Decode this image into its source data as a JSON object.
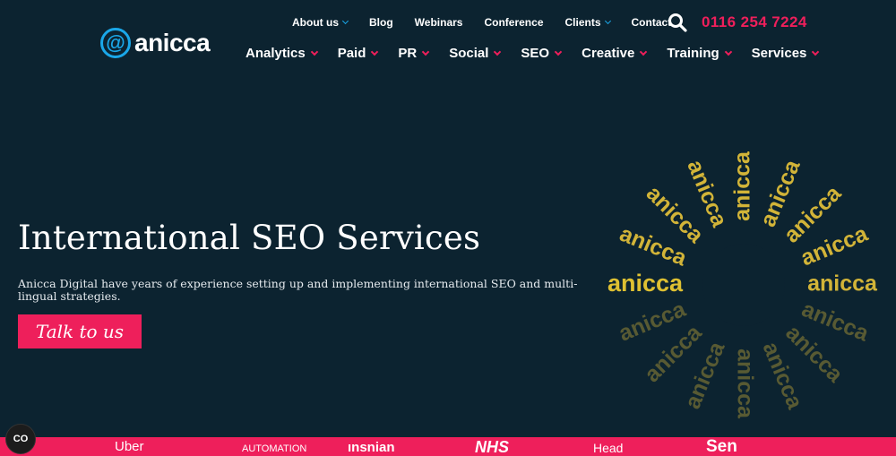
{
  "brand": {
    "name": "anicca",
    "at_symbol": "@"
  },
  "top_nav": [
    {
      "label": "About us",
      "dropdown": true
    },
    {
      "label": "Blog",
      "dropdown": false
    },
    {
      "label": "Webinars",
      "dropdown": false
    },
    {
      "label": "Conference",
      "dropdown": false
    },
    {
      "label": "Clients",
      "dropdown": true
    },
    {
      "label": "Contact",
      "dropdown": false
    }
  ],
  "phone": "0116 254 7224",
  "main_nav": [
    {
      "label": "Analytics"
    },
    {
      "label": "Paid"
    },
    {
      "label": "PR"
    },
    {
      "label": "Social"
    },
    {
      "label": "SEO"
    },
    {
      "label": "Creative"
    },
    {
      "label": "Training"
    },
    {
      "label": "Services"
    }
  ],
  "hero": {
    "title": "International SEO Services",
    "description": "Anicca Digital have years of experience setting up and implementing international SEO and multi-lingual strategies.",
    "cta_label": "Talk to us"
  },
  "graphic": {
    "word": "anicca"
  },
  "clients": [
    "Uber",
    "AUTOMATION",
    "ınsnian",
    "NHS",
    "Head",
    "Sen"
  ],
  "cookie_button": {
    "label": "CO"
  },
  "colors": {
    "background": "#0c2330",
    "accent_pink": "#ee1f5b",
    "accent_blue": "#1aa7e8",
    "gold": "#e8c43a"
  },
  "icons": {
    "search": "search-icon",
    "dropdown": "chevron-down-icon"
  }
}
